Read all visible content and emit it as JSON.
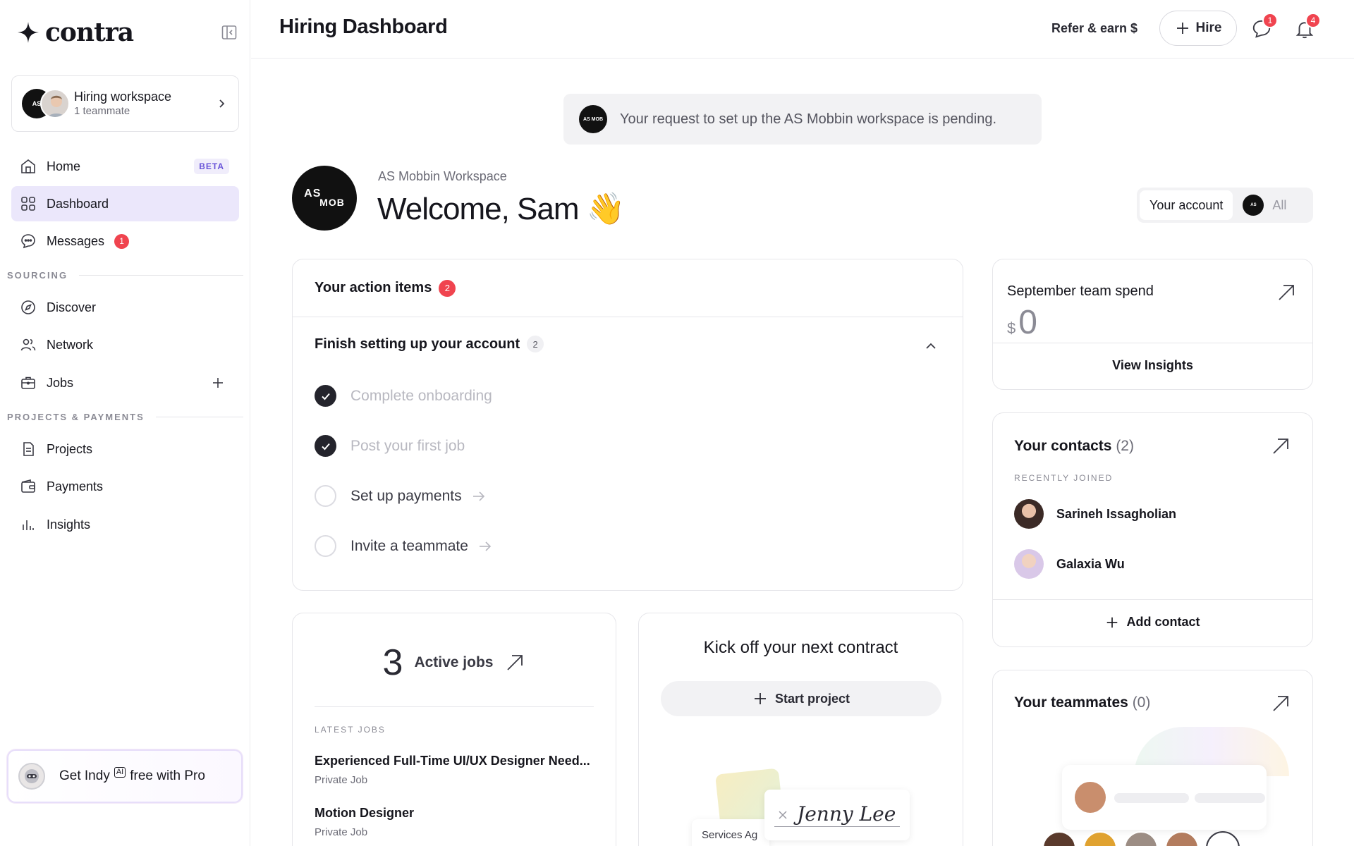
{
  "brand": {
    "name": "contra"
  },
  "workspace": {
    "title": "Hiring workspace",
    "subtitle": "1 teammate",
    "avatar_text": "AS"
  },
  "sidebar": {
    "items": [
      {
        "label": "Home",
        "badge": "BETA"
      },
      {
        "label": "Dashboard"
      },
      {
        "label": "Messages",
        "count": "1"
      },
      {
        "label": "Discover"
      },
      {
        "label": "Network"
      },
      {
        "label": "Jobs"
      },
      {
        "label": "Projects"
      },
      {
        "label": "Payments"
      },
      {
        "label": "Insights"
      }
    ],
    "sections": {
      "sourcing": "SOURCING",
      "projects_payments": "PROJECTS & PAYMENTS"
    },
    "promo": {
      "pre": "Get Indy",
      "ai": "AI",
      "post": "free with Pro"
    }
  },
  "header": {
    "title": "Hiring Dashboard",
    "refer_label": "Refer & earn $",
    "hire_label": "Hire",
    "messages_count": "1",
    "notifications_count": "4"
  },
  "banner": {
    "text": "Your request to set up the AS Mobbin workspace is pending.",
    "avatar_text": "AS MOB"
  },
  "welcome": {
    "logo_line1": "AS",
    "logo_line2": "MOB",
    "workspace_name": "AS Mobbin Workspace",
    "greeting": "Welcome, Sam",
    "emoji": "👋"
  },
  "account_toggle": {
    "selected": "Your account",
    "other": "All"
  },
  "action_items": {
    "title": "Your action items",
    "count": "2",
    "group_title": "Finish setting up your account",
    "group_count": "2",
    "tasks": [
      {
        "label": "Complete onboarding",
        "done": true
      },
      {
        "label": "Post your first job",
        "done": true
      },
      {
        "label": "Set up payments",
        "done": false
      },
      {
        "label": "Invite a teammate",
        "done": false
      }
    ]
  },
  "jobs": {
    "count": "3",
    "label": "Active jobs",
    "latest_label": "LATEST JOBS",
    "list": [
      {
        "title": "Experienced Full-Time UI/UX Designer Need...",
        "type": "Private Job"
      },
      {
        "title": "Motion Designer",
        "type": "Private Job"
      }
    ]
  },
  "contract": {
    "title": "Kick off your next contract",
    "button": "Start project",
    "signature": "Jenny Lee",
    "chip": "Services Ag"
  },
  "spend": {
    "title": "September team spend",
    "currency": "$",
    "value": "0",
    "link": "View Insights"
  },
  "contacts": {
    "title": "Your contacts",
    "count": "(2)",
    "recent_label": "RECENTLY JOINED",
    "list": [
      {
        "name": "Sarineh Issagholian"
      },
      {
        "name": "Galaxia Wu"
      }
    ],
    "add_label": "Add contact"
  },
  "teammates": {
    "title": "Your teammates",
    "count": "(0)"
  },
  "colors": {
    "accent": "#ebe7fb",
    "badge_red": "#f0444f",
    "text": "#16161d"
  }
}
